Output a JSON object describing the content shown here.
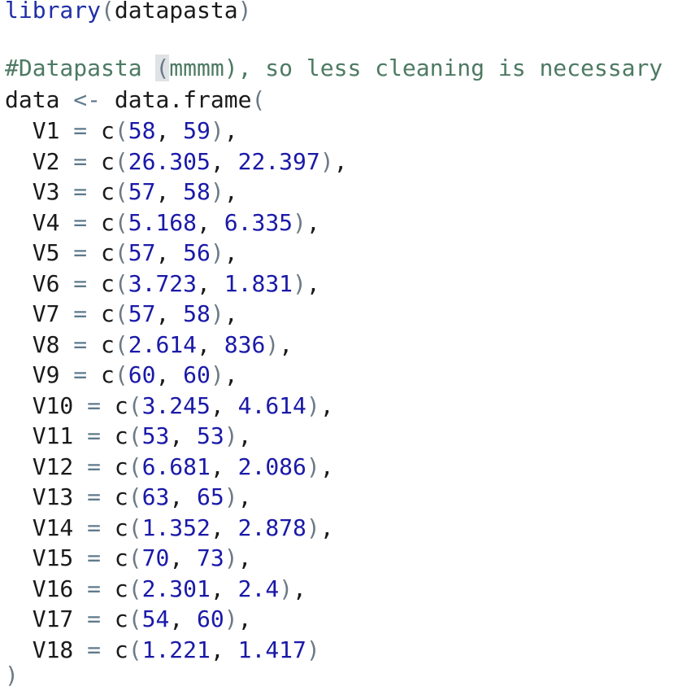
{
  "editor": {
    "library_call": {
      "fn": "library",
      "arg": "datapasta"
    },
    "comment": {
      "before": "#Datapasta ",
      "highlight": "(",
      "after": "mmmm), so less cleaning is necessary"
    },
    "assign": {
      "var": "data",
      "op": "<-",
      "fn": "data.frame"
    },
    "rows": [
      {
        "name": "V1",
        "a": "58",
        "b": "59",
        "end": "),"
      },
      {
        "name": "V2",
        "a": "26.305",
        "b": "22.397",
        "end": "),"
      },
      {
        "name": "V3",
        "a": "57",
        "b": "58",
        "end": "),"
      },
      {
        "name": "V4",
        "a": "5.168",
        "b": "6.335",
        "end": "),"
      },
      {
        "name": "V5",
        "a": "57",
        "b": "56",
        "end": "),"
      },
      {
        "name": "V6",
        "a": "3.723",
        "b": "1.831",
        "end": "),"
      },
      {
        "name": "V7",
        "a": "57",
        "b": "58",
        "end": "),"
      },
      {
        "name": "V8",
        "a": "2.614",
        "b": "836",
        "end": "),"
      },
      {
        "name": "V9",
        "a": "60",
        "b": "60",
        "end": "),"
      },
      {
        "name": "V10",
        "a": "3.245",
        "b": "4.614",
        "end": "),"
      },
      {
        "name": "V11",
        "a": "53",
        "b": "53",
        "end": "),"
      },
      {
        "name": "V12",
        "a": "6.681",
        "b": "2.086",
        "end": "),"
      },
      {
        "name": "V13",
        "a": "63",
        "b": "65",
        "end": "),"
      },
      {
        "name": "V14",
        "a": "1.352",
        "b": "2.878",
        "end": "),"
      },
      {
        "name": "V15",
        "a": "70",
        "b": "73",
        "end": "),"
      },
      {
        "name": "V16",
        "a": "2.301",
        "b": "2.4",
        "end": "),"
      },
      {
        "name": "V17",
        "a": "54",
        "b": "60",
        "end": "),"
      },
      {
        "name": "V18",
        "a": "1.221",
        "b": "1.417",
        "end": ")"
      }
    ],
    "closing": ")"
  }
}
